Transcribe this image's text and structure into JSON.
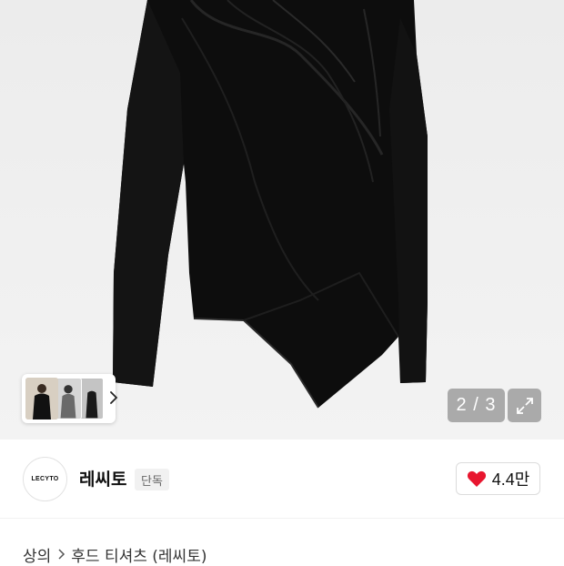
{
  "gallery": {
    "product_image_icon": "black-drape-long-sleeve-top",
    "thumbnails": [
      "thumbnail-1",
      "thumbnail-2",
      "thumbnail-3"
    ],
    "page_counter": "2 / 3",
    "expand_icon": "expand-icon"
  },
  "brand": {
    "logo_text": "LECYTO",
    "name": "레씨토",
    "badge": "단독",
    "like_count": "4.4만",
    "heart_color": "#e8162f"
  },
  "breadcrumb": {
    "items": [
      "상의",
      "후드 티셔츠 (레씨토)"
    ]
  }
}
